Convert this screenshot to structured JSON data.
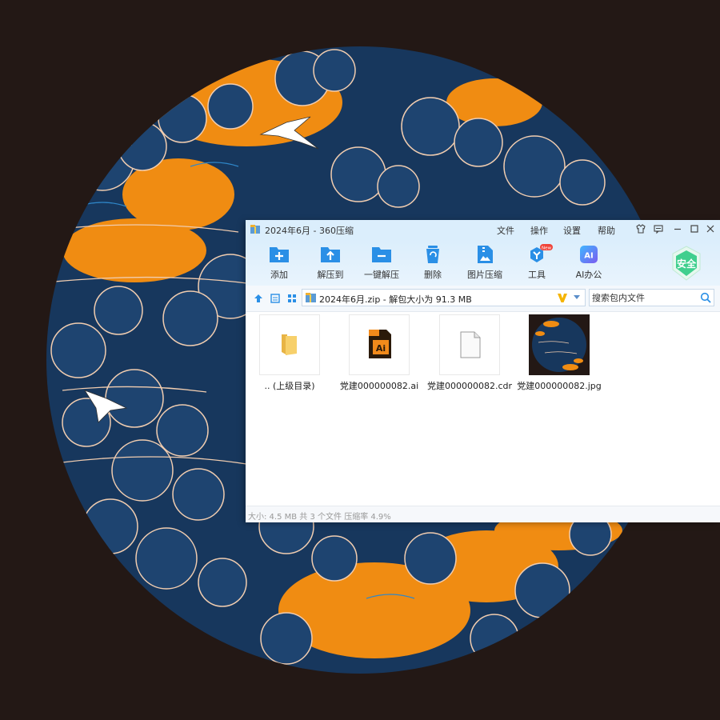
{
  "window": {
    "title": "2024年6月 - 360压缩",
    "menu": [
      "文件",
      "操作",
      "设置",
      "帮助"
    ]
  },
  "toolbar": {
    "buttons": [
      {
        "label": "添加",
        "icon": "add-icon"
      },
      {
        "label": "解压到",
        "icon": "extract-to-icon"
      },
      {
        "label": "一键解压",
        "icon": "one-click-extract-icon"
      },
      {
        "label": "删除",
        "icon": "delete-icon"
      },
      {
        "label": "图片压缩",
        "icon": "image-compress-icon"
      },
      {
        "label": "工具",
        "icon": "tools-icon",
        "badge": "New"
      },
      {
        "label": "AI办公",
        "icon": "ai-office-icon",
        "icon_text": "AI"
      }
    ],
    "safe_badge": "安全"
  },
  "address": {
    "path": "2024年6月.zip - 解包大小为 91.3 MB",
    "search_placeholder": "搜索包内文件"
  },
  "files": [
    {
      "name": ".. (上级目录)",
      "type": "folder"
    },
    {
      "name": "党建000000082.ai",
      "type": "ai",
      "icon_text": "Ai"
    },
    {
      "name": "党建000000082.cdr",
      "type": "cdr"
    },
    {
      "name": "党建000000082.jpg",
      "type": "jpg"
    }
  ],
  "status": "大小: 4.5 MB 共 3 个文件 压缩率 4.9%",
  "colors": {
    "background": "#231815",
    "cloud_navy": "#17375d",
    "sky_orange": "#f08c12",
    "toolbar_blue": "#dbeefc",
    "icon_blue": "#2a8fe6",
    "safe_green": "#3fcf8e"
  }
}
